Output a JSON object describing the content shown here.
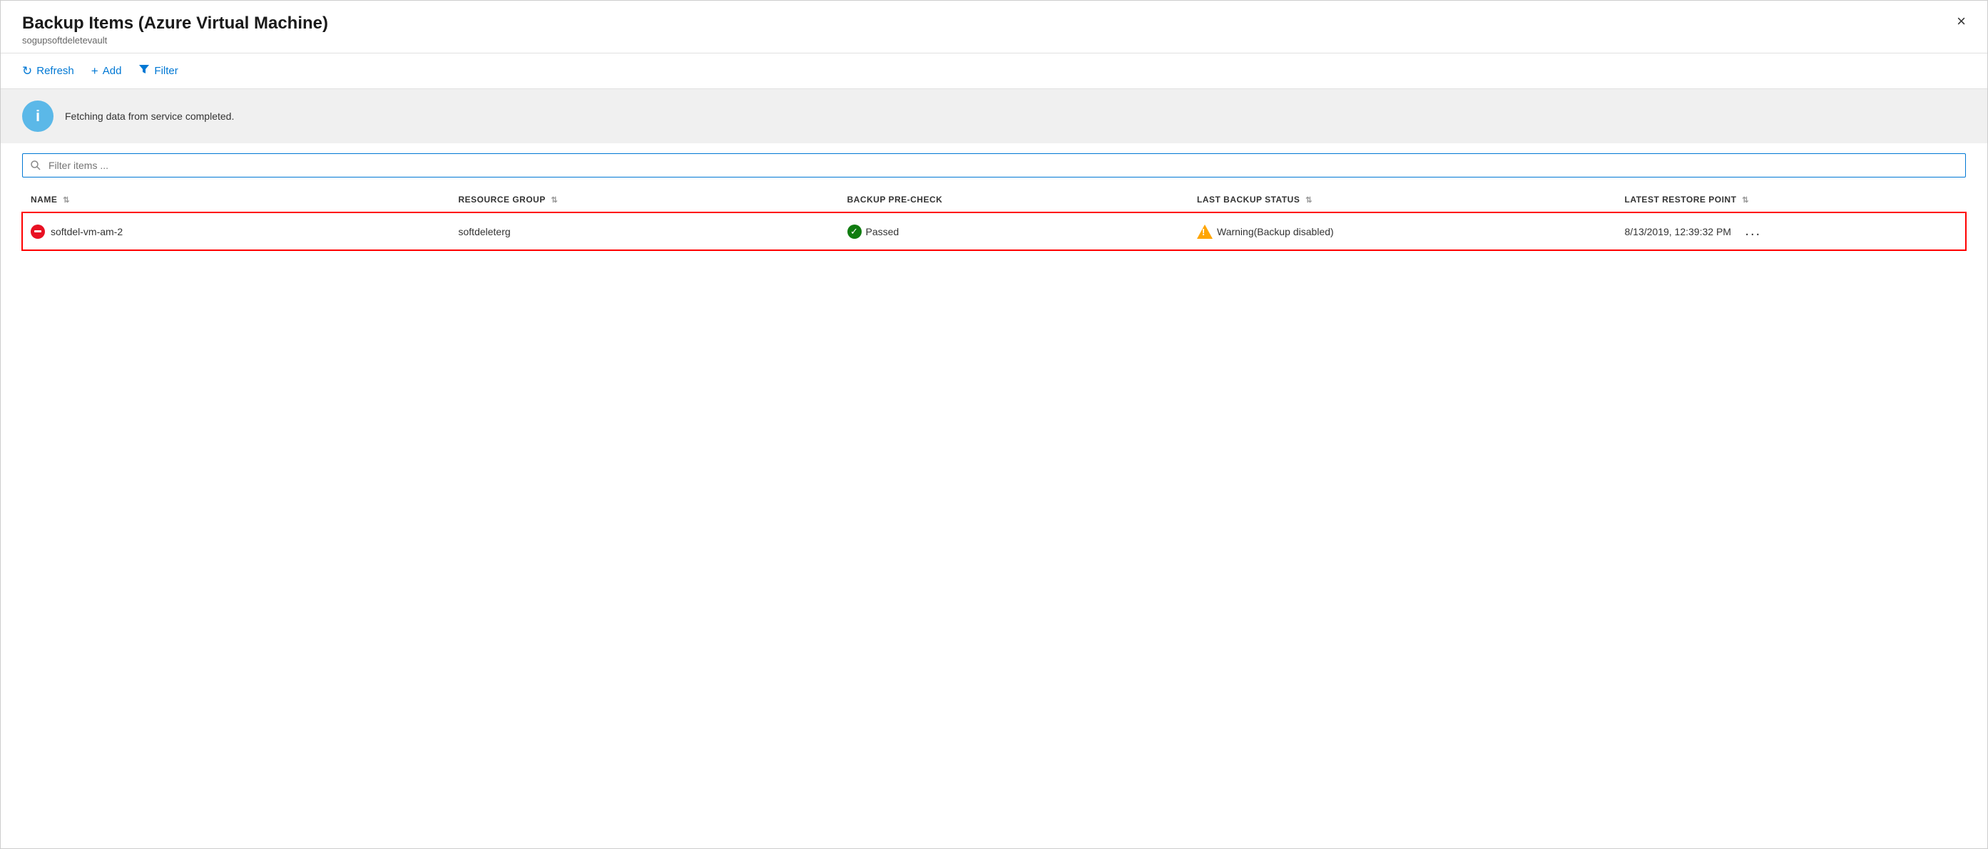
{
  "panel": {
    "title": "Backup Items (Azure Virtual Machine)",
    "subtitle": "sogupsoftdeletevault",
    "close_label": "×"
  },
  "toolbar": {
    "refresh_label": "Refresh",
    "add_label": "Add",
    "filter_label": "Filter"
  },
  "notification": {
    "message": "Fetching data from service completed."
  },
  "search": {
    "placeholder": "Filter items ..."
  },
  "table": {
    "columns": [
      {
        "key": "name",
        "label": "NAME"
      },
      {
        "key": "resource_group",
        "label": "RESOURCE GROUP"
      },
      {
        "key": "backup_pre_check",
        "label": "BACKUP PRE-CHECK"
      },
      {
        "key": "last_backup_status",
        "label": "LAST BACKUP STATUS"
      },
      {
        "key": "latest_restore_point",
        "label": "LATEST RESTORE POINT"
      }
    ],
    "rows": [
      {
        "name": "softdel-vm-am-2",
        "resource_group": "softdeleterg",
        "backup_pre_check": "Passed",
        "backup_pre_check_status": "passed",
        "last_backup_status": "Warning(Backup disabled)",
        "last_backup_status_type": "warning",
        "latest_restore_point": "8/13/2019, 12:39:32 PM",
        "selected": true
      }
    ]
  },
  "icons": {
    "refresh": "↻",
    "add": "+",
    "filter": "▼",
    "info": "i",
    "search": "🔍",
    "check": "✓",
    "warning": "⚠",
    "more": "..."
  }
}
